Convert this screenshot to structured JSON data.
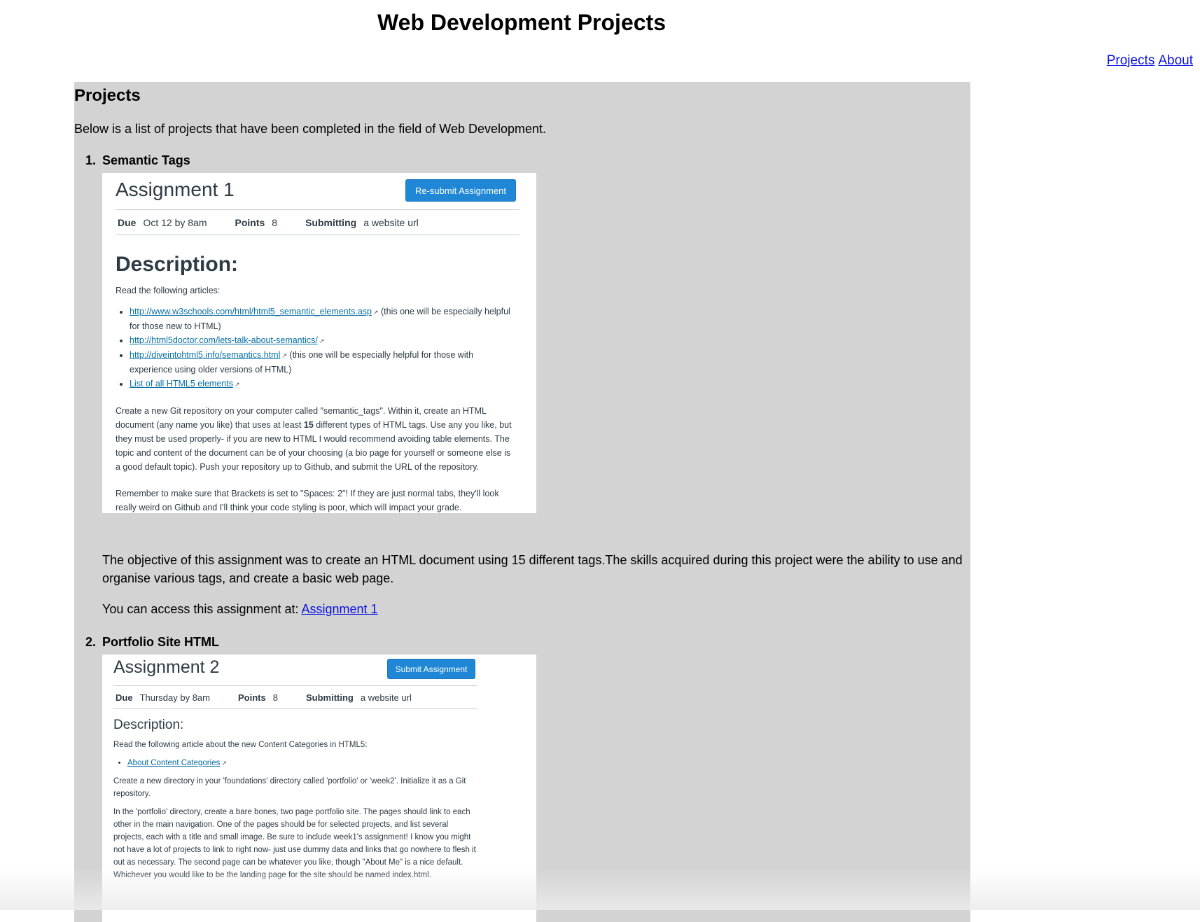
{
  "header": {
    "title": "Web Development Projects"
  },
  "nav": [
    {
      "label": "Projects"
    },
    {
      "label": "About"
    }
  ],
  "main": {
    "heading": "Projects",
    "intro": "Below is a list of projects that have been completed in the field of Web Development."
  },
  "projects": [
    {
      "number": "1.",
      "title": "Semantic Tags",
      "shot": {
        "title": "Assignment 1",
        "button": "Re-submit Assignment",
        "due_label": "Due",
        "due": "Oct 12 by 8am",
        "points_label": "Points",
        "points": "8",
        "submitting_label": "Submitting",
        "submitting": "a website url",
        "desc_heading": "Description:",
        "read_line": "Read the following articles:",
        "links": [
          {
            "text": "http://www.w3schools.com/html/html5_semantic_elements.asp",
            "after": "(this one will be especially helpful for those new to HTML)"
          },
          {
            "text": "http://html5doctor.com/lets-talk-about-semantics/",
            "after": ""
          },
          {
            "text": "http://diveintohtml5.info/semantics.html",
            "after": "(this one will be especially helpful for those with experience using older versions of HTML)"
          },
          {
            "text": "List of all HTML5 elements",
            "after": ""
          }
        ],
        "para1_a": "Create a new Git repository on your computer called \"semantic_tags\". Within it, create an HTML document (any name you like) that uses at least ",
        "para1_bold": "15",
        "para1_b": " different types of HTML tags. Use any you like, but they must be used properly- if you are new to HTML I would recommend avoiding table elements. The topic and content of the document can be of your choosing (a bio page for yourself or someone else is a good default topic). Push your repository up to Github, and submit the URL of the repository.",
        "para2": "Remember to make sure that Brackets is set to \"Spaces: 2\"! If they are just normal tabs, they'll look really weird on Github and I'll think your code styling is poor, which will impact your grade."
      },
      "objective": "The objective of this assignment was to create an HTML document using 15 different tags.The skills acquired during this project were the ability to use and organise various tags, and create a basic web page.",
      "access_text": "You can access this assignment at: ",
      "access_link": "Assignment 1"
    },
    {
      "number": "2.",
      "title": "Portfolio Site HTML",
      "shot": {
        "title": "Assignment 2",
        "button": "Submit Assignment",
        "due_label": "Due",
        "due": "Thursday by 8am",
        "points_label": "Points",
        "points": "8",
        "submitting_label": "Submitting",
        "submitting": "a website url",
        "desc_heading": "Description:",
        "read_line": "Read the following article about the new Content Categories in HTML5:",
        "links": [
          {
            "text": "About Content Categories",
            "after": ""
          }
        ],
        "para1": "Create a new directory in your 'foundations' directory called 'portfolio' or 'week2'. Initialize it as a Git repository.",
        "para2": "In the 'portfolio' directory, create a bare bones, two page portfolio site. The pages should link to each other in the main navigation. One of the pages should be for selected projects, and list several projects, each with a title and small image. Be sure to include week1's assignment! I know you might not have a lot of projects to link to right now- just use dummy data and links that go nowhere to flesh it out as necessary. The second page can be whatever you like, though \"About Me\" is a nice default. Whichever you would like to be the landing page for the site should be named index.html."
      }
    }
  ]
}
